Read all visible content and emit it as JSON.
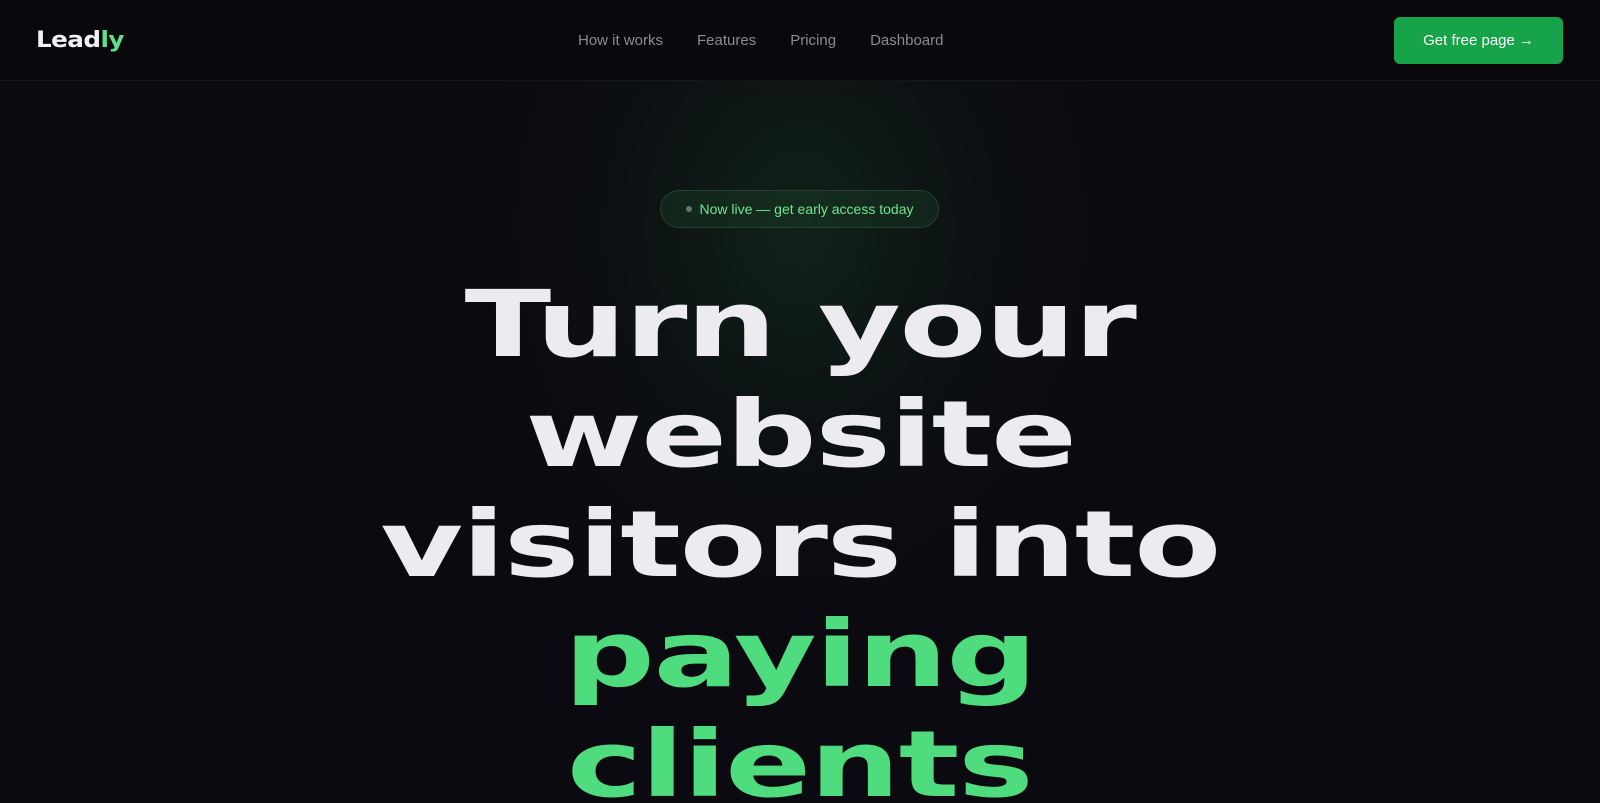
{
  "header": {
    "logo_main": "Lead",
    "logo_accent": "ly",
    "nav": [
      "How it works",
      "Features",
      "Pricing",
      "Dashboard"
    ],
    "cta_label": "Get free page",
    "cta_arrow": "→"
  },
  "hero": {
    "badge": "Now live — get early access today",
    "headline_lines": [
      "Turn your",
      "website",
      "visitors into"
    ],
    "headline_accent_lines": [
      "paying",
      "clients"
    ]
  },
  "colors": {
    "background": "#0b0a10",
    "accent": "#16a34a",
    "accent_text": "#4fdc7e",
    "headline_white": "#ececf0"
  }
}
